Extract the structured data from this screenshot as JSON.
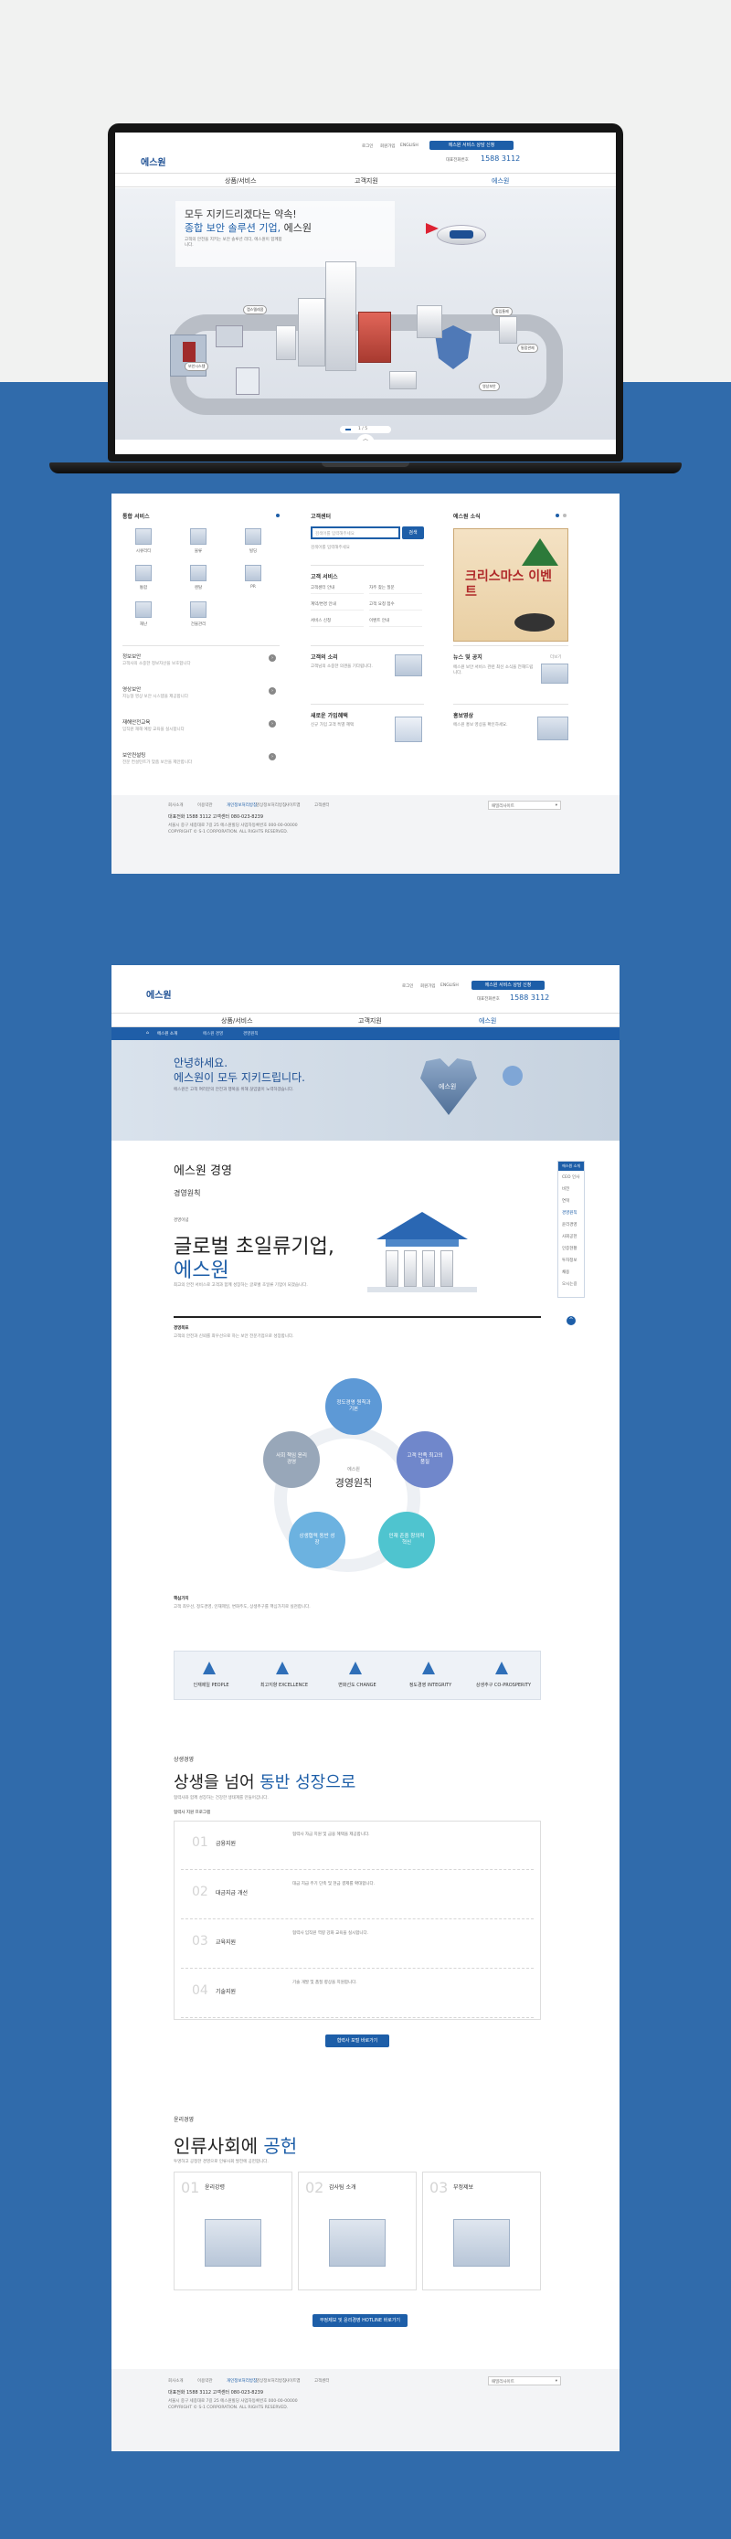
{
  "brand": {
    "logo": "에스원",
    "phone_label": "대표전화번호",
    "phone": "1588 3112",
    "cta": "에스원 서비스 상담 신청"
  },
  "top_links": [
    "로그인",
    "회원가입",
    "ENGLISH"
  ],
  "nav": [
    "상품/서비스",
    "고객지원",
    "에스원"
  ],
  "hero": {
    "line1": "모두 지키드리겠다는 약속!",
    "line2_blue": "종합 보안 솔루션 기업,",
    "line2_rest": " 에스원",
    "desc": "고객의 안전을 지키는 보안 솔루션 리더, 에스원이 함께합니다.",
    "pager": "1 / 5",
    "pill_labels": [
      "캡스텔레콤",
      "보안시스템",
      "출입통제",
      "통합관제",
      "영상보안"
    ]
  },
  "main": {
    "services_title": "통합 서비스",
    "services": [
      "시큐리티",
      "물류",
      "빌딩",
      "통합",
      "렌탈",
      "PR",
      "재난",
      "건물관리"
    ],
    "service_list": [
      {
        "title": "정보보안",
        "desc": "고객사의 소중한 정보자산을 보호합니다"
      },
      {
        "title": "영상보안",
        "desc": "지능형 영상 보안 시스템을 제공합니다"
      },
      {
        "title": "재해안전교육",
        "desc": "임직원 재해 예방 교육을 실시합니다"
      },
      {
        "title": "보안컨설팅",
        "desc": "전문 컨설턴트가 맞춤 보안을 제안합니다"
      }
    ],
    "search_title": "고객센터",
    "search_placeholder": "검색어를 입력해주세요",
    "search_button": "검색",
    "customer_title": "고객 서비스",
    "customer_links": [
      "고객센터 안내",
      "자주 찾는 질문",
      "계약/변경 안내",
      "고객 요청 접수",
      "서비스 신청",
      "이벤트 안내"
    ],
    "news_title": "에스원 소식",
    "news_more": "더보기",
    "event_text": "크리스마스 이벤트",
    "notice_title": "뉴스 및 공지",
    "notice_text": "에스원 보안 서비스 관련 최신 소식을 전해드립니다.",
    "cust_talk_title": "고객의 소리",
    "cust_talk_text": "고객님의 소중한 의견을 기다립니다.",
    "new_title": "새로운 가입혜택",
    "new_text": "신규 가입 고객 특별 혜택",
    "promo_title": "홍보영상",
    "promo_text": "에스원 홍보 영상을 확인하세요."
  },
  "footer": {
    "links": [
      "회사소개",
      "이용약관",
      "개인정보처리방침",
      "영상정보처리방침",
      "사이트맵",
      "고객센터"
    ],
    "phone_row": "대표전화 1588 3112   고객센터 080-023-8239",
    "address": "서울시 중구 세종대로 7길 25 에스원빌딩   사업자등록번호 000-00-00000",
    "copyright": "COPYRIGHT © S-1 CORPORATION. ALL RIGHTS RESERVED.",
    "family_site": "패밀리사이트"
  },
  "sub": {
    "crumbs": [
      "에스원 소개",
      "에스원 경영",
      "경영원칙"
    ],
    "hero_line1": "안녕하세요.",
    "hero_line2": "에스원이 모두 지키드립니다.",
    "hero_desc": "에스원은 고객 여러분의 안전과 행복을 위해 끊임없이 노력하겠습니다.",
    "page_title": "에스원 경영",
    "sub_title": "경영원칙",
    "vision_label": "경영이념",
    "vision_line1": "글로벌 초일류기업,",
    "vision_line2": "에스원",
    "vision_desc": "최고의 안전 서비스로 고객과 함께 성장하는 글로벌 초일류 기업이 되겠습니다.",
    "goal_label": "경영목표",
    "goal_desc": "고객의 안전과 신뢰를 최우선으로 하는 보안 전문기업으로 성장합니다.",
    "side_title": "에스원 소개",
    "side_items": [
      "CEO 인사",
      "비전",
      "연혁",
      "경영원칙",
      "윤리경영",
      "사회공헌",
      "인증현황",
      "투자정보",
      "채용",
      "오시는길"
    ],
    "principle_center_small": "에스원",
    "principle_center": "경영원칙",
    "principles": [
      "정도경영 원칙과 기본",
      "고객 만족 최고의 품질",
      "인재 존중 창의적 혁신",
      "상생협력 동반 성장",
      "사회 책임 윤리 경영"
    ],
    "core_label": "핵심가치",
    "core_desc": "고객 최우선, 정도경영, 인재제일, 변화주도, 상생추구를 핵심가치로 실천합니다.",
    "values": [
      "인재제일 PEOPLE",
      "최고지향 EXCELLENCE",
      "변화선도 CHANGE",
      "정도경영 INTEGRITY",
      "상생추구 CO-PROSPERITY"
    ],
    "sangsaeng_label": "상생경영",
    "sangsaeng_line_pre": "상생을 넘어 ",
    "sangsaeng_line_blue": "동반 성장으로",
    "sangsaeng_desc": "협력사와 함께 성장하는 건강한 생태계를 만들어갑니다.",
    "program_label": "협력사 지원 프로그램",
    "programs": [
      {
        "num": "01",
        "title": "금융지원",
        "desc": "협력사 자금 지원 및 금융 혜택을 제공합니다."
      },
      {
        "num": "02",
        "title": "대금지급 개선",
        "desc": "대금 지급 주기 단축 및 현금 결제를 확대합니다."
      },
      {
        "num": "03",
        "title": "교육지원",
        "desc": "협력사 임직원 역량 강화 교육을 실시합니다."
      },
      {
        "num": "04",
        "title": "기술지원",
        "desc": "기술 개발 및 품질 향상을 지원합니다."
      }
    ],
    "program_button": "협력사 포털 바로가기",
    "ethics_label": "윤리경영",
    "ethics_pre": "인류사회에 ",
    "ethics_blue": "공헌",
    "ethics_desc": "투명하고 공정한 경영으로 인류사회 발전에 공헌합니다.",
    "ethics": [
      {
        "num": "01",
        "title": "윤리강령"
      },
      {
        "num": "02",
        "title": "감사팀 소개"
      },
      {
        "num": "03",
        "title": "부정제보"
      }
    ],
    "ethics_button": "부정제보 및 윤리경영 HOTLINE 바로가기"
  }
}
